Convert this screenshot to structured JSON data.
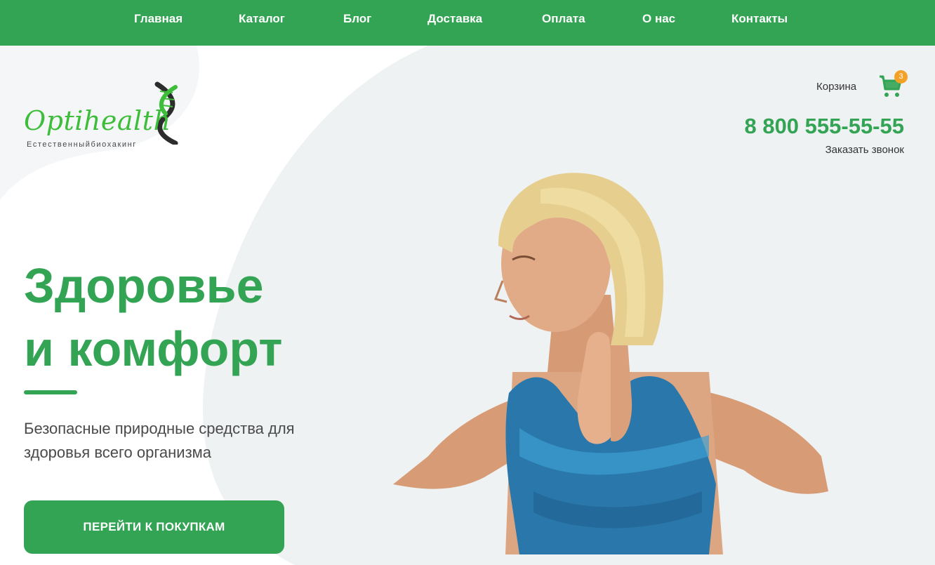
{
  "nav": {
    "items": [
      {
        "label": "Главная"
      },
      {
        "label": "Каталог"
      },
      {
        "label": "Блог"
      },
      {
        "label": "Доставка"
      },
      {
        "label": "Оплата"
      },
      {
        "label": "О нас"
      },
      {
        "label": "Контакты"
      }
    ]
  },
  "logo": {
    "name": "Optihealth",
    "tagline": "Естественныйбиохакинг"
  },
  "header": {
    "cart_label": "Корзина",
    "cart_count": "3",
    "phone": "8 800 555-55-55",
    "callback": "Заказать звонок"
  },
  "hero": {
    "title_line1": "Здоровье",
    "title_line2": "и комфорт",
    "subtitle": "Безопасные природные средства для здоровья всего организма",
    "cta_label": "ПЕРЕЙТИ К ПОКУПКАМ"
  },
  "colors": {
    "brand_green": "#33a354",
    "badge_orange": "#f4a227",
    "background": "#eff2f3"
  },
  "icons": {
    "cart": "cart-icon",
    "logo_mark": "dna-icon"
  }
}
